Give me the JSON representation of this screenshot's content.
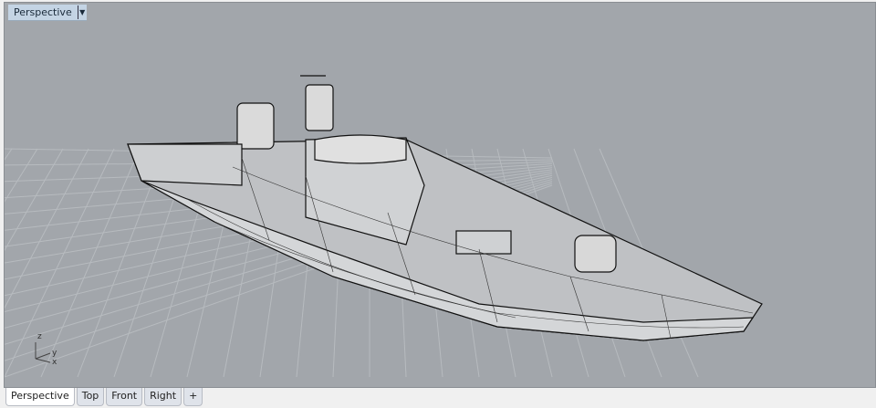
{
  "viewport": {
    "title": "Perspective",
    "axes": {
      "z": "z",
      "y": "y",
      "x": "x"
    }
  },
  "tabs": [
    {
      "label": "Perspective",
      "active": true
    },
    {
      "label": "Top"
    },
    {
      "label": "Front"
    },
    {
      "label": "Right"
    },
    {
      "label": "+"
    }
  ],
  "colors": {
    "viewport_bg": "#a2a6ab",
    "title_bg": "#c4d4e4",
    "grid": "#b4b8bc"
  }
}
